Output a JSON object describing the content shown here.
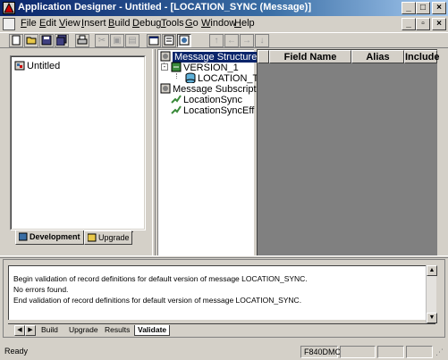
{
  "window": {
    "title": "Application Designer - Untitled - [LOCATION_SYNC (Message)]"
  },
  "menu": [
    "File",
    "Edit",
    "View",
    "Insert",
    "Build",
    "Debug",
    "Tools",
    "Go",
    "Window",
    "Help"
  ],
  "menu_underline": [
    "F",
    "E",
    "V",
    "I",
    "B",
    "D",
    "T",
    "G",
    "W",
    "H"
  ],
  "toolbar": {
    "icons": [
      "new-icon",
      "open-icon",
      "save-icon",
      "save-all-icon",
      "print-icon",
      "cut-icon",
      "copy-icon",
      "paste-icon",
      "project-workspace-icon",
      "properties-icon",
      "insert-definition-icon",
      "move-up-icon",
      "move-left-icon",
      "move-right-icon",
      "move-down-icon"
    ]
  },
  "project": {
    "root_label": "Untitled",
    "tabs": [
      {
        "label": "Development",
        "active": true
      },
      {
        "label": "Upgrade",
        "active": false
      }
    ]
  },
  "message_tree": {
    "items": [
      {
        "label": "Message Structure",
        "selected": true
      },
      {
        "label": "VERSION_1"
      },
      {
        "label": "LOCATION_TBL"
      },
      {
        "label": "Message Subscriptions"
      },
      {
        "label": "LocationSync"
      },
      {
        "label": "LocationSyncEff"
      }
    ]
  },
  "grid": {
    "columns": [
      "Field Name",
      "Alias",
      "Include"
    ]
  },
  "output": {
    "lines": [
      "Begin validation of record definitions for default version of message LOCATION_SYNC.",
      "No errors found.",
      "End validation of record definitions for default version of message LOCATION_SYNC."
    ],
    "tabs": [
      {
        "label": "Build",
        "active": false
      },
      {
        "label": "Upgrade",
        "active": false
      },
      {
        "label": "Results",
        "active": false
      },
      {
        "label": "Validate",
        "active": true
      }
    ]
  },
  "status": {
    "text": "Ready",
    "database": "F840DMO"
  },
  "colors": {
    "face": "#d4d0c8",
    "title_active": "#0a246a",
    "selection": "#0a246a"
  }
}
